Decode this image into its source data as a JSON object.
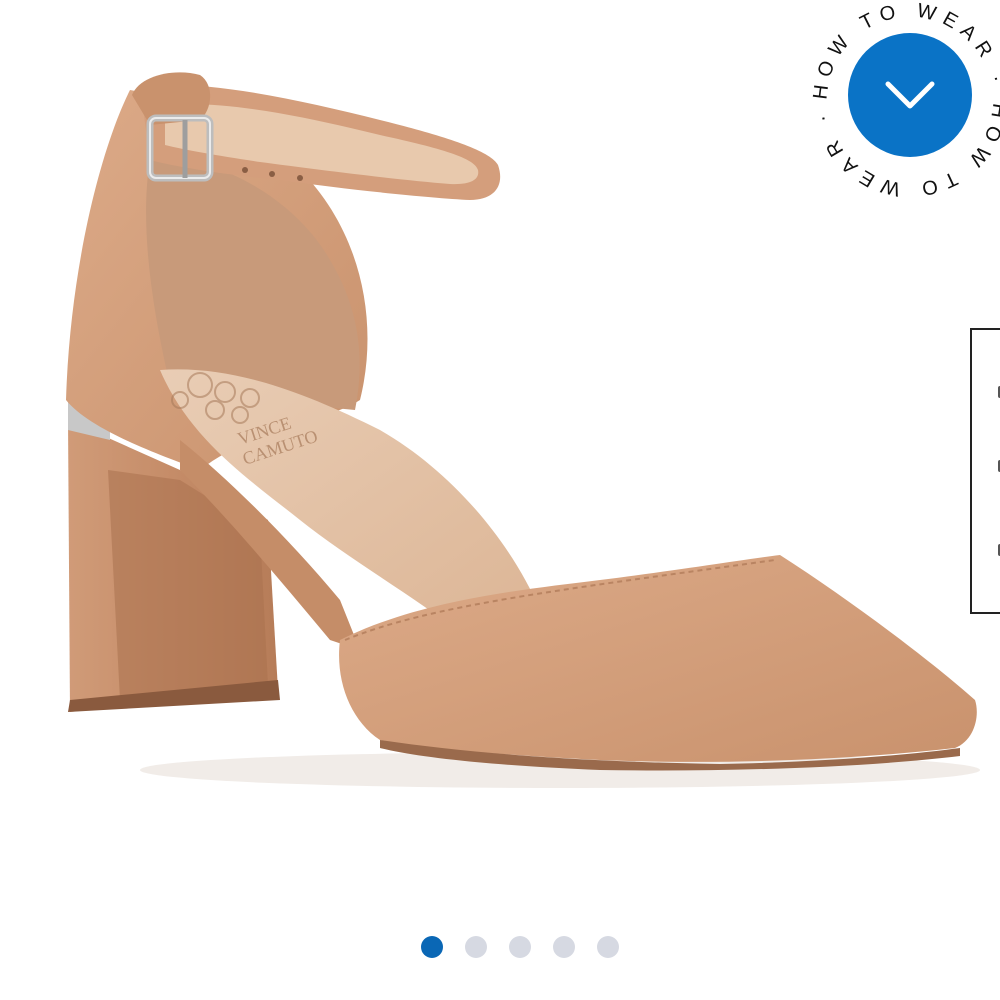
{
  "badge": {
    "ring_text": "HOW TO WEAR · HOW TO WEAR · ",
    "accent_color": "#0a73c6",
    "icon": "chevron-down-icon"
  },
  "product_image": {
    "logo_text_line1": "VINCE",
    "logo_text_line2": "CAMUTO",
    "shoe_color": "#d9a683"
  },
  "carousel": {
    "total": 5,
    "active_index": 0,
    "active_color": "#0a67b5",
    "inactive_color": "#d6d9e2"
  }
}
